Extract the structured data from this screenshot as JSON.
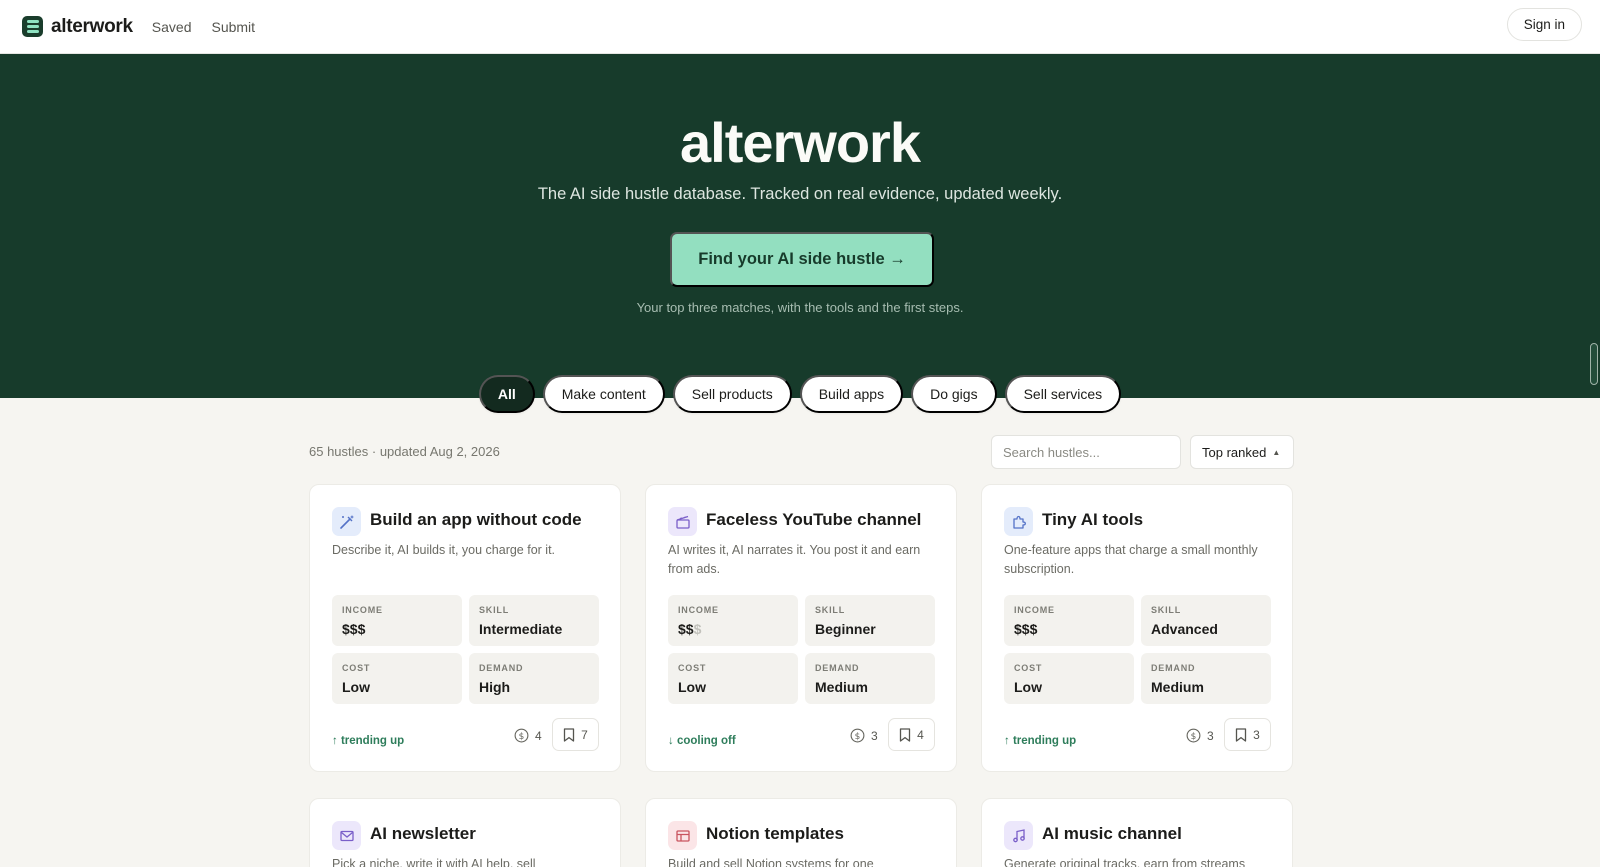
{
  "nav": {
    "brand": "alterwork",
    "links": [
      "Saved",
      "Submit"
    ],
    "signin": "Sign in"
  },
  "hero": {
    "title": "alterwork",
    "subtitle": "The AI side hustle database. Tracked on real evidence, updated weekly.",
    "cta": "Find your AI side hustle →",
    "note": "Your top three matches, with the tools and the first steps."
  },
  "filters": {
    "categories": [
      "All",
      "Make content",
      "Sell products",
      "Build apps",
      "Do gigs",
      "Sell services"
    ],
    "active": "All"
  },
  "list": {
    "meta": "65 hustles · updated Aug 2, 2026",
    "search_placeholder": "Search hustles...",
    "sort": "Top ranked",
    "labels": {
      "income": "INCOME",
      "skill": "SKILL",
      "cost": "COST",
      "demand": "DEMAND"
    }
  },
  "cards": [
    {
      "title": "Build an app without code",
      "desc": "Describe it, AI builds it, you charge for it.",
      "icon": "magic-wand-icon",
      "income": "$$$",
      "income_dim": "",
      "skill": "Intermediate",
      "cost": "Low",
      "demand": "High",
      "trend": "↑ trending up",
      "coins": "4",
      "saves": "7"
    },
    {
      "title": "Faceless YouTube channel",
      "desc": "AI writes it, AI narrates it. You post it and earn from ads.",
      "icon": "clapperboard-icon",
      "income": "$$",
      "income_dim": "$",
      "skill": "Beginner",
      "cost": "Low",
      "demand": "Medium",
      "trend": "↓ cooling off",
      "coins": "3",
      "saves": "4"
    },
    {
      "title": "Tiny AI tools",
      "desc": "One-feature apps that charge a small monthly subscription.",
      "icon": "puzzle-icon",
      "income": "$$$",
      "income_dim": "",
      "skill": "Advanced",
      "cost": "Low",
      "demand": "Medium",
      "trend": "↑ trending up",
      "coins": "3",
      "saves": "3"
    },
    {
      "title": "AI newsletter",
      "desc": "Pick a niche, write it with AI help, sell",
      "icon": "envelope-icon"
    },
    {
      "title": "Notion templates",
      "desc": "Build and sell Notion systems for one",
      "icon": "layout-icon"
    },
    {
      "title": "AI music channel",
      "desc": "Generate original tracks, earn from streams",
      "icon": "music-note-icon"
    }
  ],
  "colors": {
    "hero_bg": "#173b2b",
    "cta_bg": "#93dfc0",
    "trend_color": "#2e7d5b",
    "active_pill": "#132a1f"
  }
}
